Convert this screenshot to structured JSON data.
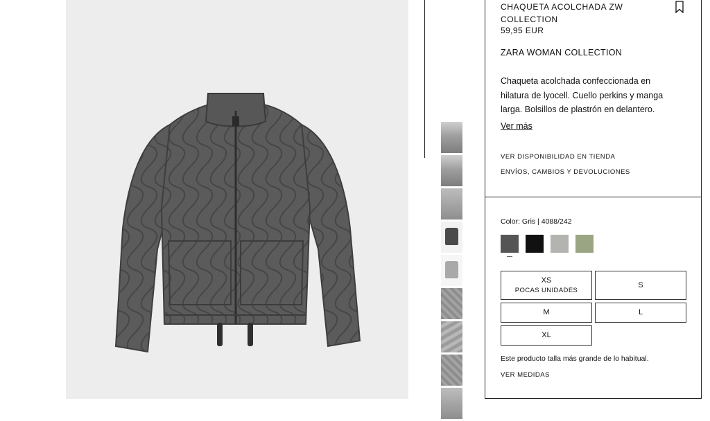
{
  "product": {
    "title": "CHAQUETA ACOLCHADA ZW COLLECTION",
    "price": "59,95 EUR",
    "collection": "ZARA WOMAN COLLECTION",
    "description": "Chaqueta acolchada confeccionada en hilatura de lyocell. Cuello perkins y manga larga. Bolsillos de plastrón en delantero. Bajo",
    "more_label": "Ver más"
  },
  "links": {
    "availability": "VER DISPONIBILIDAD EN TIENDA",
    "shipping": "ENVÍOS, CAMBIOS Y DEVOLUCIONES",
    "measures": "VER MEDIDAS"
  },
  "color": {
    "label": "Color: Gris | 4088/242",
    "swatches": [
      {
        "name": "dark-grey",
        "hex": "#555555",
        "selected": true
      },
      {
        "name": "black",
        "hex": "#111111",
        "selected": false
      },
      {
        "name": "light-grey",
        "hex": "#b3b3b0",
        "selected": false
      },
      {
        "name": "sage",
        "hex": "#9aa584",
        "selected": false
      }
    ]
  },
  "sizes": [
    {
      "label": "XS",
      "note": "POCAS UNIDADES"
    },
    {
      "label": "S",
      "note": ""
    },
    {
      "label": "M",
      "note": ""
    },
    {
      "label": "L",
      "note": ""
    },
    {
      "label": "XL",
      "note": ""
    }
  ],
  "fit_note": "Este producto talla más grande de lo habitual.",
  "icons": {
    "bookmark": "bookmark-icon"
  }
}
